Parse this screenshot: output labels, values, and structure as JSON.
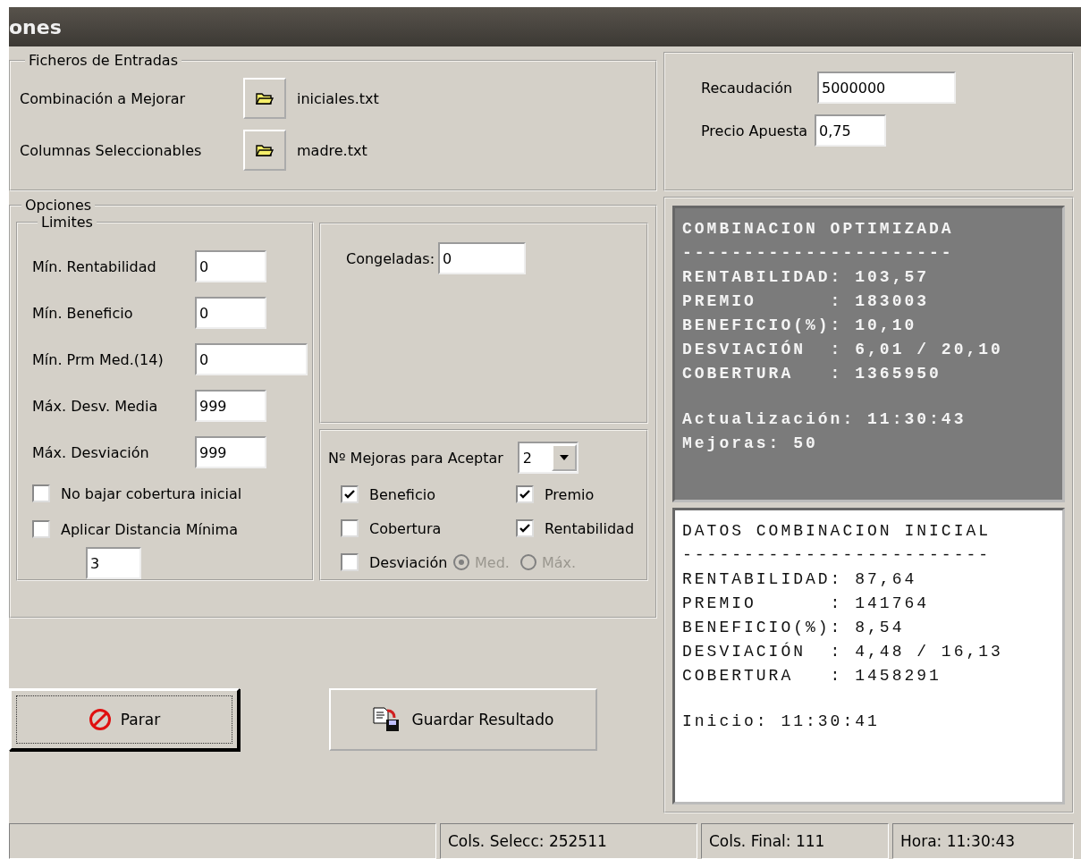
{
  "window": {
    "title": "ones"
  },
  "input_files": {
    "title": "Ficheros de Entradas",
    "rows": [
      {
        "label": "Combinación a Mejorar",
        "file": "iniciales.txt"
      },
      {
        "label": "Columnas Seleccionables",
        "file": "madre.txt"
      }
    ]
  },
  "bet": {
    "fields": [
      {
        "label": "Recaudación",
        "value": "5000000"
      },
      {
        "label": "Precio Apuesta",
        "value": "0,75"
      }
    ]
  },
  "options": {
    "title": "Opciones",
    "limits": {
      "title": "Limites",
      "fields": [
        {
          "label": "Mín. Rentabilidad",
          "value": "0"
        },
        {
          "label": "Mín. Beneficio",
          "value": "0"
        },
        {
          "label": "Mín. Prm Med.(14)",
          "value": "0"
        },
        {
          "label": "Máx. Desv. Media",
          "value": "999"
        },
        {
          "label": "Máx. Desviación",
          "value": "999"
        }
      ],
      "checkboxes": [
        {
          "label": "No bajar cobertura inicial",
          "checked": false
        },
        {
          "label": "Aplicar Distancia Mínima",
          "checked": false
        }
      ],
      "distance_value": "3"
    },
    "frozen": {
      "label": "Congeladas:",
      "value": "0"
    },
    "improvements": {
      "label": "Nº Mejoras para Aceptar",
      "value": "2",
      "checkboxes": [
        {
          "label": "Beneficio",
          "checked": true
        },
        {
          "label": "Premio",
          "checked": true
        },
        {
          "label": "Cobertura",
          "checked": false
        },
        {
          "label": "Rentabilidad",
          "checked": true
        },
        {
          "label": "Desviación",
          "checked": false
        }
      ],
      "radios": [
        {
          "label": "Med.",
          "selected": true,
          "disabled": true
        },
        {
          "label": "Máx.",
          "selected": false,
          "disabled": true
        }
      ]
    }
  },
  "buttons": [
    {
      "kind": "stop",
      "label": "Parar",
      "focused": true
    },
    {
      "kind": "save",
      "label": "Guardar Resultado",
      "focused": false
    }
  ],
  "optimized": {
    "lines": [
      "COMBINACION OPTIMIZADA",
      "----------------------",
      "RENTABILIDAD: 103,57",
      "PREMIO      : 183003",
      "BENEFICIO(%): 10,10",
      "DESVIACIÓN  : 6,01 / 20,10",
      "COBERTURA   : 1365950"
    ],
    "footer_lines": [
      "Actualización: 11:30:43",
      "Mejoras: 50"
    ]
  },
  "initial": {
    "lines": [
      "DATOS COMBINACION INICIAL",
      "-------------------------",
      "RENTABILIDAD: 87,64",
      "PREMIO      : 141764",
      "BENEFICIO(%): 8,54",
      "DESVIACIÓN  : 4,48 / 16,13",
      "COBERTURA   : 1458291"
    ],
    "footer_lines": [
      "Inicio: 11:30:41"
    ]
  },
  "status_bar": [
    "Cols. Selecc: 252511",
    "Cols. Final: 111",
    "Hora: 11:30:43"
  ]
}
